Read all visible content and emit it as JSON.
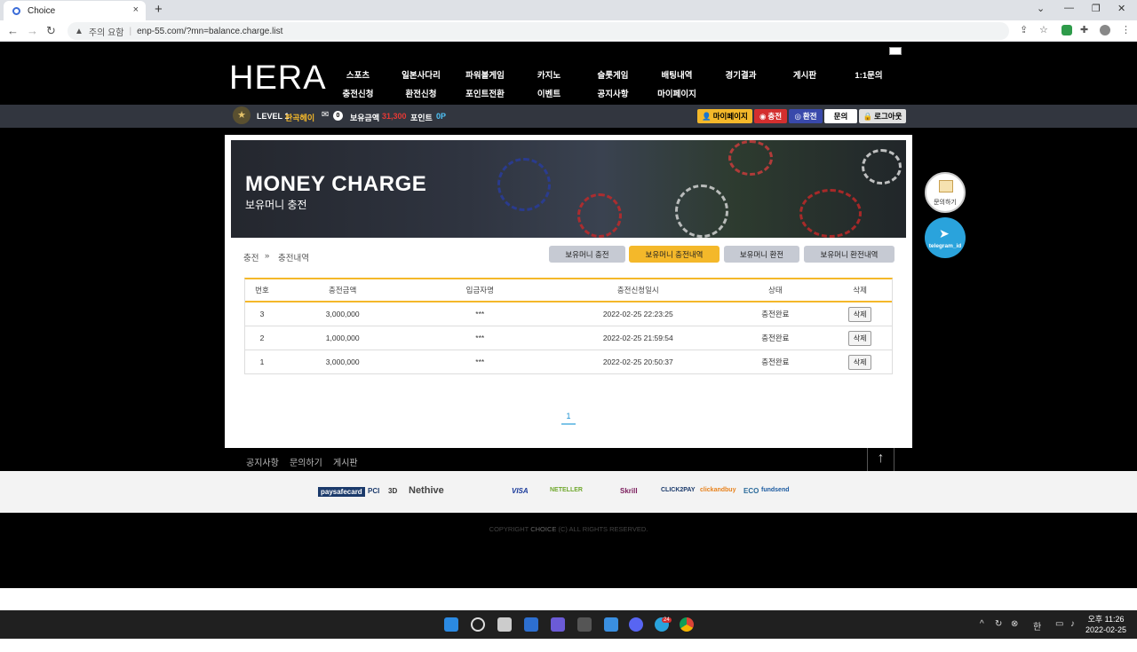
{
  "browser": {
    "tab_title": "Choice",
    "new_tab": "+",
    "tab_close": "×",
    "security_warning": "주의 요함",
    "url": "enp-55.com/?mn=balance.charge.list"
  },
  "header": {
    "logo": "HERA",
    "menu_row1": [
      "스포츠",
      "일본사다리",
      "파워볼게임",
      "카지노",
      "슬롯게임",
      "배팅내역",
      "경기결과",
      "게시판",
      "1:1문의"
    ],
    "menu_row2": [
      "충전신청",
      "환전신청",
      "포인트전환",
      "이벤트",
      "공지사항",
      "마이페이지"
    ]
  },
  "user_bar": {
    "level": "LEVEL 1",
    "nickname": "판곡헤이",
    "message_count": "0",
    "balance_label": "보유금액",
    "balance_value": "31,300",
    "point_label": "포인트",
    "point_value": "0P",
    "buttons": {
      "mypage": "마이페이지",
      "charge": "충전",
      "exchange": "환전",
      "inquiry": "문의",
      "logout": "로그아웃"
    }
  },
  "banner": {
    "title": "MONEY CHARGE",
    "subtitle": "보유머니 충전"
  },
  "breadcrumb": {
    "parent": "충전",
    "separator": "»",
    "current": "충전내역"
  },
  "tabs": [
    "보유머니 충전",
    "보유머니 충전내역",
    "보유머니 환전",
    "보유머니 환전내역"
  ],
  "table": {
    "headers": [
      "번호",
      "충전금액",
      "입금자명",
      "충전신청일시",
      "상태",
      "삭제"
    ],
    "rows": [
      {
        "no": "3",
        "amount": "3,000,000",
        "depositor": "***",
        "datetime": "2022-02-25 22:23:25",
        "status": "충전완료",
        "delete": "삭제"
      },
      {
        "no": "2",
        "amount": "1,000,000",
        "depositor": "***",
        "datetime": "2022-02-25 21:59:54",
        "status": "충전완료",
        "delete": "삭제"
      },
      {
        "no": "1",
        "amount": "3,000,000",
        "depositor": "***",
        "datetime": "2022-02-25 20:50:37",
        "status": "충전완료",
        "delete": "삭제"
      }
    ]
  },
  "pagination": {
    "current_page": "1"
  },
  "floating": {
    "inquiry": "문의하기",
    "telegram": "telegram_id"
  },
  "footer": {
    "nav": [
      "공지사항",
      "문의하기",
      "게시판"
    ],
    "payment_logos": [
      "paysafecard",
      "PCI",
      "3D",
      "Nethive",
      "VISA",
      "NETELLER",
      "Skrill",
      "CLICK2PAY",
      "clickandbuy",
      "ECO",
      "fundsend"
    ],
    "copyright": "COPYRIGHT",
    "brand": "CHOICE",
    "rights": "(C) ALL RIGHTS RESERVED."
  },
  "taskbar": {
    "ime": "한",
    "time": "오후 11:26",
    "date": "2022-02-25",
    "badge": "24"
  },
  "colors": {
    "accent": "#f4b82a",
    "balance": "#e53935",
    "point": "#4fc3f7",
    "nickname": "#f4b82a"
  }
}
